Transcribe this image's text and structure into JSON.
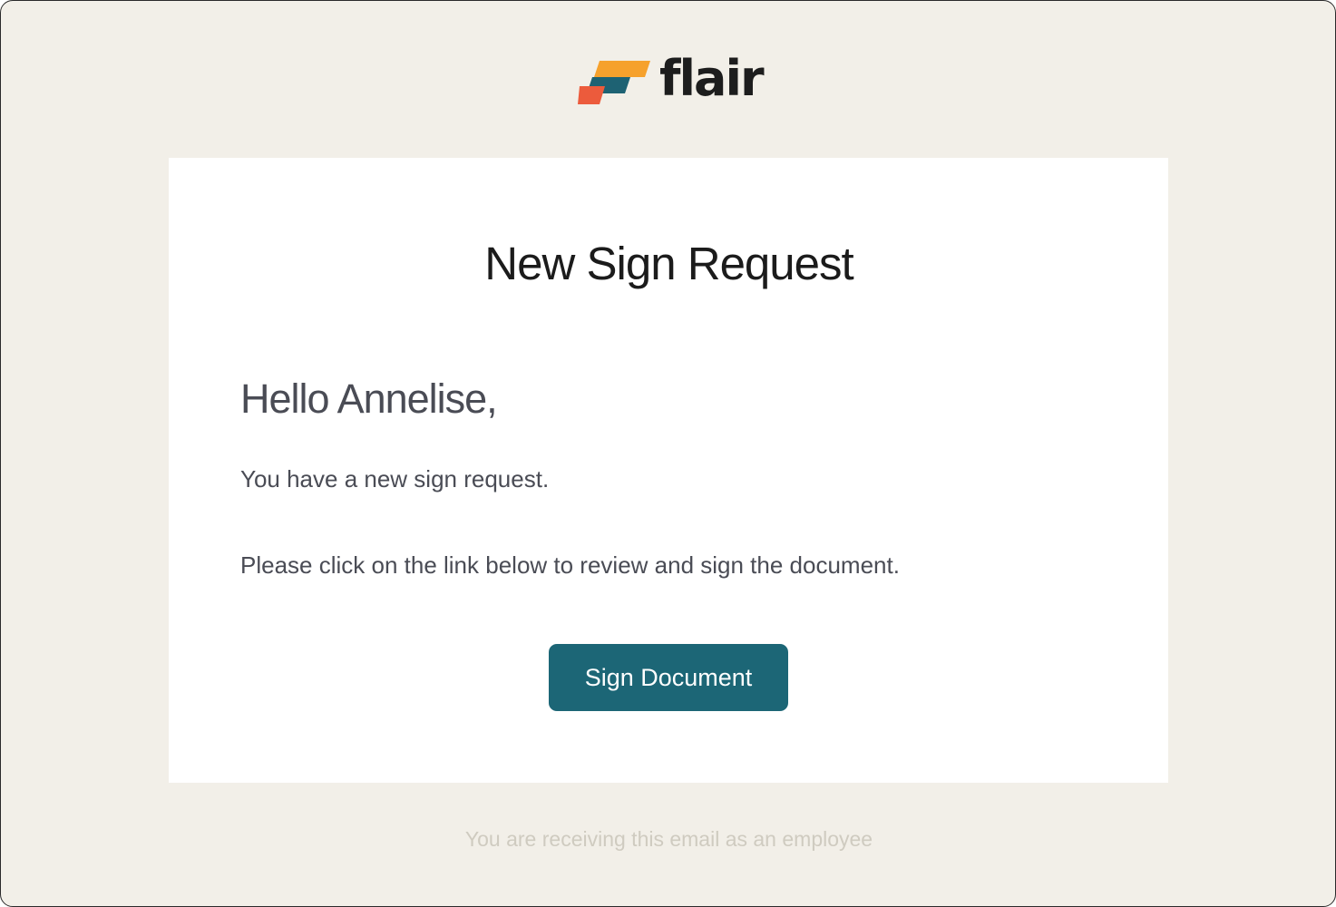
{
  "brand": {
    "name": "flair",
    "logo_icon": "flair-logo-icon",
    "colors": {
      "orange": "#f6a12c",
      "teal": "#1e6273",
      "coral": "#ec5b3c"
    }
  },
  "email": {
    "title": "New Sign Request",
    "greeting": "Hello Annelise,",
    "paragraphs": [
      "You have a new sign request.",
      "Please click on the link below to review and sign the document."
    ],
    "button_label": "Sign Document",
    "footer": "You are receiving this email as an employee"
  },
  "colors": {
    "background": "#f2efe8",
    "card": "#ffffff",
    "button": "#1c6676",
    "body_text": "#4a4c55",
    "footer_text": "#cfcbc0"
  }
}
